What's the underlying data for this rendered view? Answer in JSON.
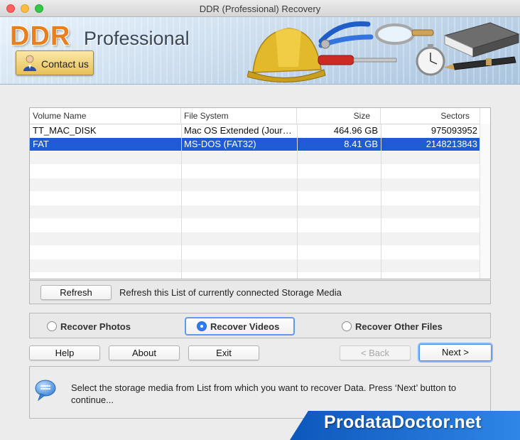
{
  "window": {
    "title": "DDR (Professional) Recovery"
  },
  "banner": {
    "brand_primary": "DDR",
    "brand_secondary": "Professional",
    "contact_label": "Contact us"
  },
  "table": {
    "columns": [
      "Volume Name",
      "File System",
      "Size",
      "Sectors"
    ],
    "rows": [
      {
        "volume": "TT_MAC_DISK",
        "fs": "Mac OS Extended (Jour…",
        "size": "464.96  GB",
        "sectors": "975093952",
        "selected": false
      },
      {
        "volume": "FAT",
        "fs": "MS-DOS (FAT32)",
        "size": "8.41  GB",
        "sectors": "2148213843",
        "selected": true
      }
    ]
  },
  "refresh": {
    "button_label": "Refresh",
    "description": "Refresh this List of currently connected Storage Media"
  },
  "recover_options": [
    {
      "label": "Recover Photos",
      "selected": false
    },
    {
      "label": "Recover Videos",
      "selected": true
    },
    {
      "label": "Recover Other Files",
      "selected": false
    }
  ],
  "buttons": {
    "help": "Help",
    "about": "About",
    "exit": "Exit",
    "back": "< Back",
    "next": "Next >"
  },
  "message": "Select the storage media from List from which you want to recover Data. Press ‘Next’ button to continue...",
  "watermark": "ProdataDoctor.net",
  "colors": {
    "selection": "#1e5cd5",
    "brand_orange": "#e8801f",
    "radio_accent": "#2f7cf6",
    "watermark_blue": "#0d57bb"
  }
}
